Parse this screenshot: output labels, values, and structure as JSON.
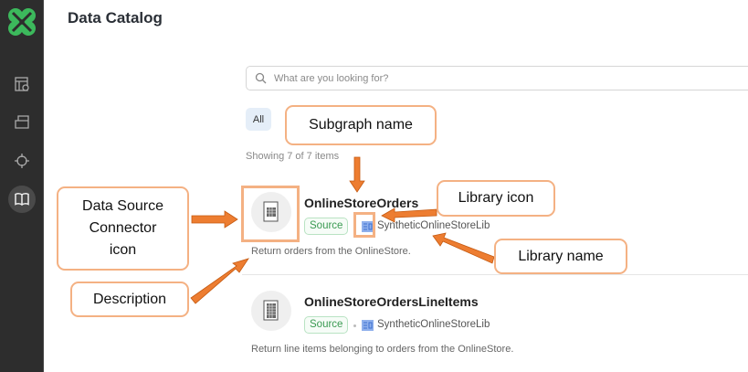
{
  "sidebar": {
    "logo": "clover-logo",
    "items": [
      {
        "icon": "catalog-table-icon",
        "active": false
      },
      {
        "icon": "folder-icon",
        "active": false
      },
      {
        "icon": "crosshair-icon",
        "active": false
      },
      {
        "icon": "book-open-icon",
        "active": true
      }
    ]
  },
  "header": {
    "title": "Data Catalog"
  },
  "search": {
    "placeholder": "What are you looking for?",
    "value": ""
  },
  "filters": [
    {
      "label": "All",
      "selected": true
    }
  ],
  "results_count": "Showing 7 of 7 items",
  "items": [
    {
      "name": "OnlineStoreOrders",
      "badge": "Source",
      "library": "SyntheticOnlineStoreLib",
      "description": "Return orders from the OnlineStore."
    },
    {
      "name": "OnlineStoreOrdersLineItems",
      "badge": "Source",
      "library": "SyntheticOnlineStoreLib",
      "description": "Return line items belonging to orders from the OnlineStore."
    }
  ],
  "annotations": {
    "subgraph_name": "Subgraph name",
    "library_icon": "Library icon",
    "library_name": "Library name",
    "connector_icon": "Data Source Connector icon",
    "description": "Description"
  },
  "colors": {
    "sidebar": "#2d2d2d",
    "logo": "#3cb95c",
    "badge": "#3a9a52",
    "annotation_border": "#f4b183",
    "arrow": "#ed7d31"
  }
}
